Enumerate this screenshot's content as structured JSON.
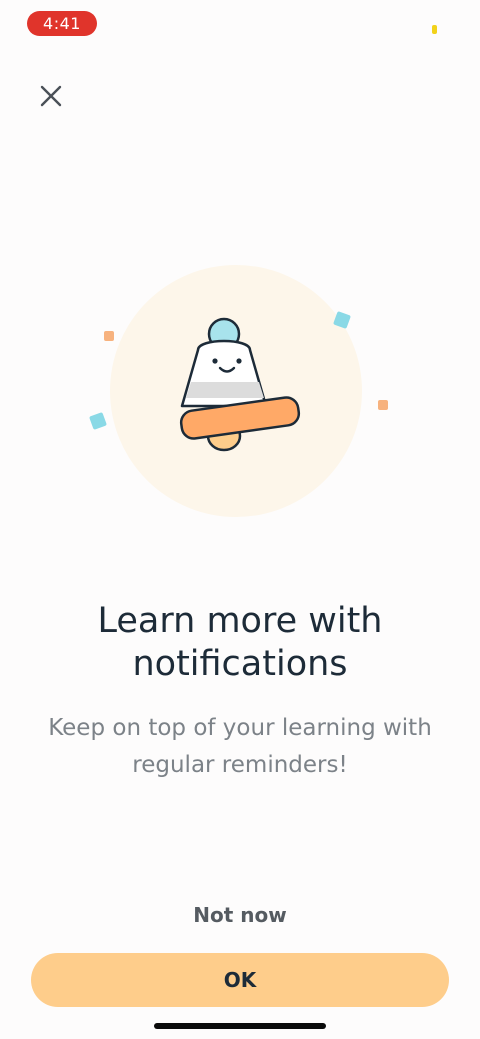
{
  "status_bar": {
    "time": "4:41"
  },
  "header": {
    "close_icon": "close-icon"
  },
  "illustration": {
    "icon": "bell-mascot-icon"
  },
  "content": {
    "title": "Learn more with notifications",
    "subtitle": "Keep on top of your learning with regular reminders!"
  },
  "actions": {
    "secondary_label": "Not now",
    "primary_label": "OK"
  },
  "colors": {
    "accent": "#fecd8b",
    "status_pill": "#e0342b",
    "title_text": "#1d2b38",
    "body_text": "#7c8288"
  }
}
